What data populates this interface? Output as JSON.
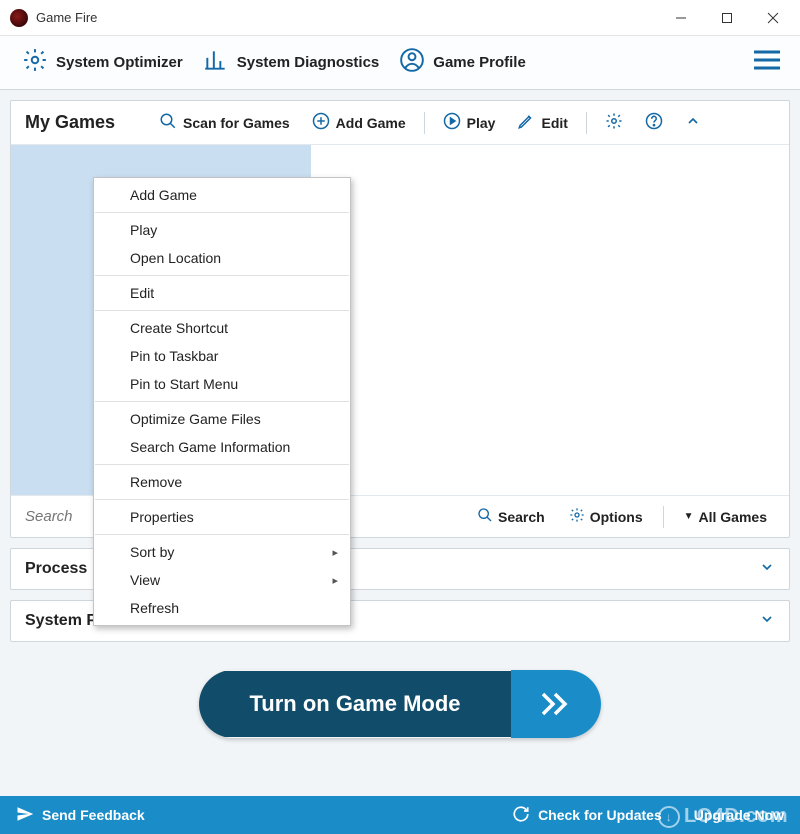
{
  "titlebar": {
    "title": "Game Fire"
  },
  "toolbar": {
    "system_optimizer": "System Optimizer",
    "system_diagnostics": "System Diagnostics",
    "game_profile": "Game Profile"
  },
  "mygames": {
    "title": "My Games",
    "scan": "Scan for Games",
    "add": "Add Game",
    "play": "Play",
    "edit": "Edit"
  },
  "search": {
    "placeholder": "Search",
    "search_label": "Search",
    "options_label": "Options",
    "allgames_label": "All Games"
  },
  "context_menu": {
    "add_game": "Add Game",
    "play": "Play",
    "open_location": "Open Location",
    "edit": "Edit",
    "create_shortcut": "Create Shortcut",
    "pin_taskbar": "Pin to Taskbar",
    "pin_start": "Pin to Start Menu",
    "optimize": "Optimize Game Files",
    "search_info": "Search Game Information",
    "remove": "Remove",
    "properties": "Properties",
    "sort_by": "Sort by",
    "view": "View",
    "refresh": "Refresh"
  },
  "panels": {
    "process": "Process",
    "system_performance": "System Performance"
  },
  "game_mode": {
    "label": "Turn on Game Mode"
  },
  "footer": {
    "send_feedback": "Send Feedback",
    "check_updates": "Check for Updates",
    "upgrade_now": "Upgrade Now"
  },
  "watermark": "LO4D.com"
}
